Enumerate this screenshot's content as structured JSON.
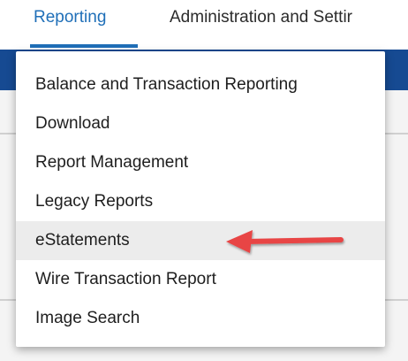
{
  "nav": {
    "tabs": [
      {
        "label": "Reporting"
      },
      {
        "label": "Administration and Settir"
      }
    ]
  },
  "dropdown": {
    "items": [
      {
        "label": "Balance and Transaction Reporting"
      },
      {
        "label": "Download"
      },
      {
        "label": "Report Management"
      },
      {
        "label": "Legacy Reports"
      },
      {
        "label": "eStatements"
      },
      {
        "label": "Wire Transaction Report"
      },
      {
        "label": "Image Search"
      }
    ]
  },
  "colors": {
    "accent": "#1f6fb8",
    "band": "#164a92",
    "highlight": "#ececec",
    "annotation_arrow": "#e84545"
  },
  "annotation": {
    "icon": "red-arrow-pointing-left",
    "target": "eStatements"
  }
}
